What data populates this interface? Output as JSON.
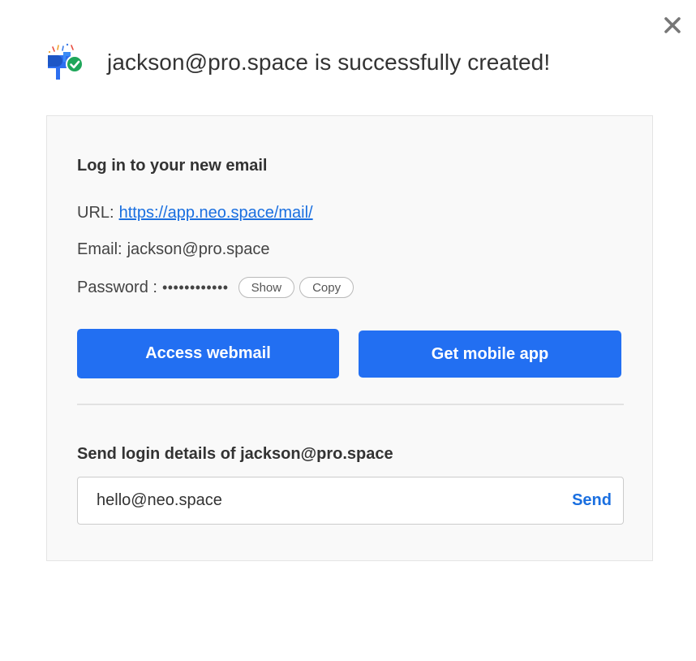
{
  "header": {
    "logo_icon": "mailbox-check-icon",
    "title": "jackson@pro.space is successfully created!",
    "close_icon": "close-icon"
  },
  "login": {
    "title": "Log in to your new email",
    "url_label": "URL:",
    "url_value": "https://app.neo.space/mail/",
    "email_label": "Email:",
    "email_value": "jackson@pro.space",
    "password_label": "Password :",
    "password_mask": "••••••••••••",
    "show_label": "Show",
    "copy_label": "Copy"
  },
  "actions": {
    "webmail_label": "Access webmail",
    "mobile_label": "Get mobile app"
  },
  "send": {
    "title": "Send login details of jackson@pro.space",
    "input_value": "hello@neo.space",
    "send_label": "Send"
  },
  "colors": {
    "primary": "#226ff2",
    "link": "#1a6fe0",
    "card_bg": "#f9f9f9",
    "success": "#1fa65a"
  }
}
